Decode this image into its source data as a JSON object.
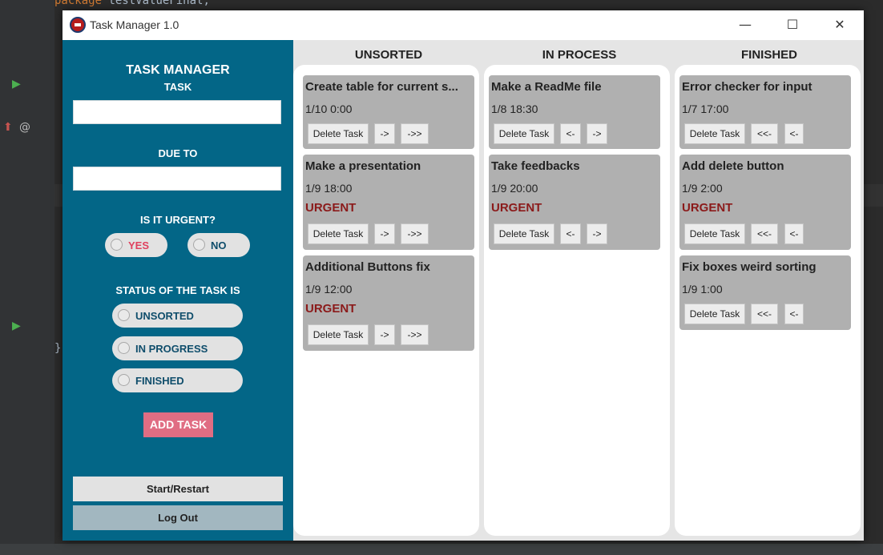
{
  "ide": {
    "line1_keyword": "package",
    "line1_rest": "testValueFinal;",
    "brace": "}"
  },
  "window": {
    "title": "Task Manager 1.0",
    "minimize_glyph": "—",
    "maximize_glyph": "☐",
    "close_glyph": "✕"
  },
  "sidebar": {
    "app_title": "TASK MANAGER",
    "task_label": "TASK",
    "task_value": "",
    "due_label": "DUE  TO",
    "due_value": "",
    "urgent_label": "IS IT URGENT?",
    "urgent_options": [
      "YES",
      "NO"
    ],
    "status_label": "STATUS OF THE TASK IS",
    "status_options": [
      "UNSORTED",
      "IN PROGRESS",
      "FINISHED"
    ],
    "add_task": "ADD TASK",
    "start_restart": "Start/Restart",
    "log_out": "Log Out"
  },
  "columns": [
    {
      "header": "UNSORTED",
      "cards": [
        {
          "title": "Create table for current s...",
          "date": "1/10 0:00",
          "urgent": "",
          "buttons": [
            "Delete Task",
            "->",
            "->>"
          ]
        },
        {
          "title": "Make a presentation",
          "date": "1/9 18:00",
          "urgent": "URGENT",
          "buttons": [
            "Delete Task",
            "->",
            "->>"
          ]
        },
        {
          "title": "Additional Buttons fix",
          "date": "1/9 12:00",
          "urgent": "URGENT",
          "buttons": [
            "Delete Task",
            "->",
            "->>"
          ]
        }
      ]
    },
    {
      "header": "IN PROCESS",
      "cards": [
        {
          "title": "Make a ReadMe file",
          "date": "1/8 18:30",
          "urgent": "",
          "buttons": [
            "Delete Task",
            "<-",
            "->"
          ]
        },
        {
          "title": "Take feedbacks",
          "date": "1/9 20:00",
          "urgent": "URGENT",
          "buttons": [
            "Delete Task",
            "<-",
            "->"
          ]
        }
      ]
    },
    {
      "header": "FINISHED",
      "cards": [
        {
          "title": "Error checker for input",
          "date": "1/7 17:00",
          "urgent": "",
          "buttons": [
            "Delete Task",
            "<<-",
            "<-"
          ]
        },
        {
          "title": "Add delete button",
          "date": "1/9 2:00",
          "urgent": "URGENT",
          "buttons": [
            "Delete Task",
            "<<-",
            "<-"
          ]
        },
        {
          "title": "Fix boxes weird sorting",
          "date": "1/9 1:00",
          "urgent": "",
          "buttons": [
            "Delete Task",
            "<<-",
            "<-"
          ]
        }
      ]
    }
  ],
  "colors": {
    "sidebar_bg": "#036687",
    "add_task_bg": "#e06d83",
    "urgent_text": "#8b1a1a",
    "yes_text": "#e0405e",
    "option_text": "#0f4d6b",
    "logout_bg": "#a2b7c0"
  }
}
